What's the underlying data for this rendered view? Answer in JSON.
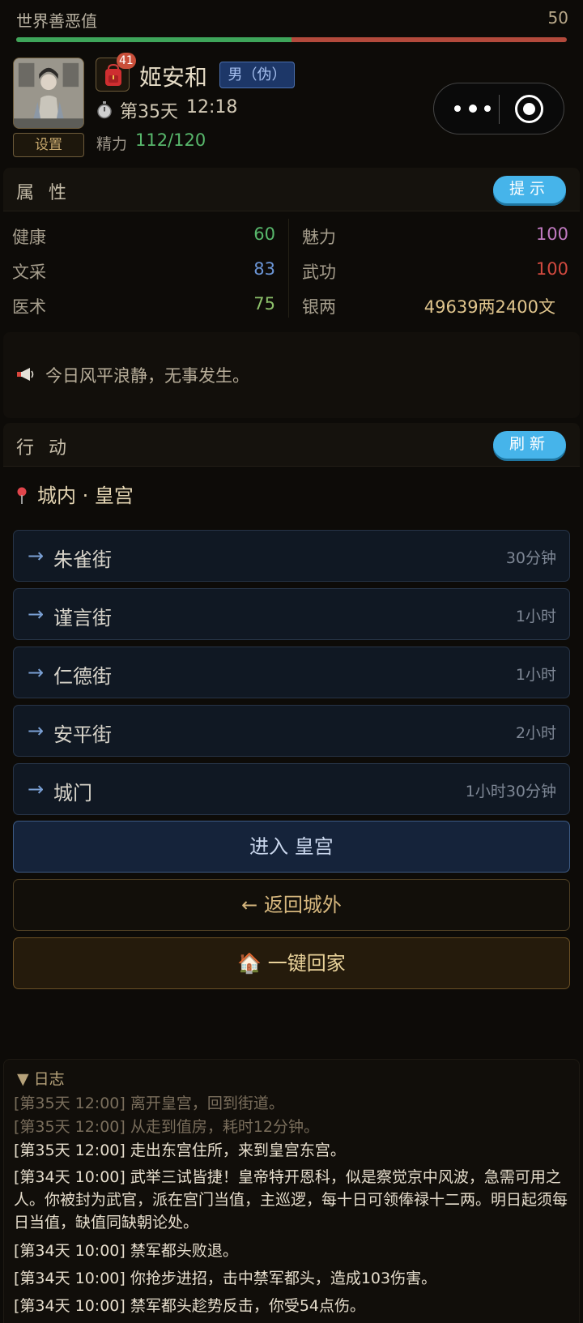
{
  "karma": {
    "label": "世界善恶值",
    "value": "50",
    "good_fraction": 0.5
  },
  "player": {
    "name": "姬安和",
    "gender_tag": "男（伪）",
    "day": "第35天",
    "time": "12:18",
    "energy_label": "精力",
    "energy_value": "112/120",
    "settings_label": "设置",
    "bag_badge": "41"
  },
  "attributes": {
    "title": "属性",
    "hint_label": "提示",
    "items": [
      {
        "name": "健康",
        "value": "60",
        "color": "#58b86c"
      },
      {
        "name": "魅力",
        "value": "100",
        "color": "#c27bc2"
      },
      {
        "name": "文采",
        "value": "83",
        "color": "#6b95d6"
      },
      {
        "name": "武功",
        "value": "100",
        "color": "#d24a3f"
      },
      {
        "name": "医术",
        "value": "75",
        "color": "#8cc06a"
      },
      {
        "name": "银两",
        "value": "49639两2400文",
        "color": "#e0c58d"
      }
    ]
  },
  "notice": {
    "text": "今日风平浪静，无事发生。"
  },
  "actions": {
    "title": "行动",
    "refresh_label": "刷新",
    "location": "城内 · 皇宫",
    "routes": [
      {
        "arrow": "→",
        "name": "朱雀街",
        "time": "30分钟"
      },
      {
        "arrow": "→",
        "name": "谨言街",
        "time": "1小时"
      },
      {
        "arrow": "→",
        "name": "仁德街",
        "time": "1小时"
      },
      {
        "arrow": "→",
        "name": "安平街",
        "time": "2小时"
      },
      {
        "arrow": "→",
        "name": "城门",
        "time": "1小时30分钟"
      }
    ],
    "enter_label": "进入 皇宫",
    "back_label": "← 返回城外",
    "home_label": "🏠 一键回家"
  },
  "log": {
    "header": "▼ 日志",
    "lines": [
      {
        "text": "[第35天 12:00] 离开皇宫，回到街道。",
        "style": "old"
      },
      {
        "text": "[第35天 12:00] 从走到值房，耗时12分钟。",
        "style": "old"
      },
      {
        "text": "[第35天 12:00] 走出东宫住所，来到皇宫东宫。",
        "style": "new"
      },
      {
        "text": "[第34天 10:00] 武举三试皆捷！皇帝特开恩科，似是察觉京中风波，急需可用之人。你被封为武官，派在宫门当值，主巡逻，每十日可领俸禄十二两。明日起须每日当值，缺值同缺朝论处。",
        "style": "new"
      },
      {
        "text": "[第34天 10:00] 禁军都头败退。",
        "style": "new"
      },
      {
        "text": "[第34天 10:00] 你抢步进招，击中禁军都头，造成103伤害。",
        "style": "new"
      },
      {
        "text": "[第34天 10:00] 禁军都头趁势反击，你受54点伤。",
        "style": "new"
      }
    ]
  }
}
